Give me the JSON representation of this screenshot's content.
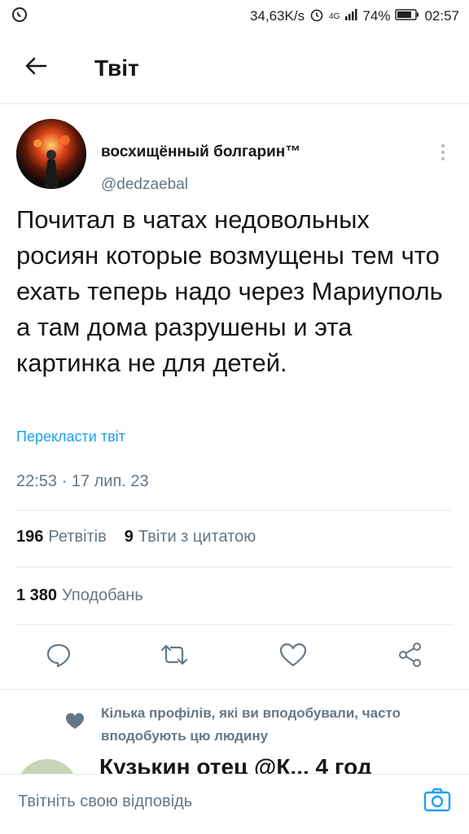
{
  "status_bar": {
    "speed": "34,63K/s",
    "network": "4G",
    "battery": "74%",
    "time": "02:57"
  },
  "header": {
    "title": "Твіт"
  },
  "tweet": {
    "author_name": "восхищённый болгарин™",
    "author_handle": "@dedzaebal",
    "text": "Почитал в чатах недовольных росиян которые возмущены тем что ехать теперь надо через Мариуполь а там дома разрушены и эта картинка не для детей.",
    "translate_label": "Перекласти твіт",
    "timestamp": "22:53 · 17 лип. 23",
    "retweets_count": "196",
    "retweets_label": "Ретвітів",
    "quotes_count": "9",
    "quotes_label": "Твіти з цитатою",
    "likes_count": "1 380",
    "likes_label": "Уподобань"
  },
  "recommendation": {
    "text": "Кілька профілів, які ви вподобували, часто вподобують цю людину"
  },
  "reply_preview": {
    "text": "Кузькин отец @К... 4 год"
  },
  "composer": {
    "placeholder": "Твітніть свою відповідь"
  },
  "colors": {
    "accent": "#1da1f2",
    "secondary_text": "#657786",
    "divider": "#e6ecf0"
  },
  "icons": [
    "back-arrow-icon",
    "more-vertical-icon",
    "reply-icon",
    "retweet-icon",
    "like-icon",
    "share-icon",
    "heart-icon",
    "camera-icon"
  ]
}
